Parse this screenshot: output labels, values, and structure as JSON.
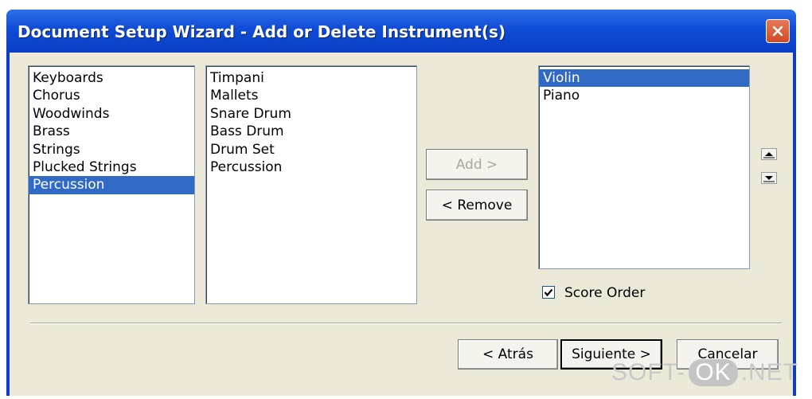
{
  "window": {
    "title": "Document Setup Wizard - Add or Delete Instrument(s)"
  },
  "categories": {
    "items": [
      "Keyboards",
      "Chorus",
      "Woodwinds",
      "Brass",
      "Strings",
      "Plucked Strings",
      "Percussion"
    ],
    "selected": "Percussion"
  },
  "instruments": {
    "items": [
      "Timpani",
      "Mallets",
      "Snare Drum",
      "Bass Drum",
      "Drum Set",
      "Percussion"
    ]
  },
  "selected_instruments": {
    "items": [
      "Violin",
      "Piano"
    ],
    "selected": "Violin"
  },
  "buttons": {
    "add": "Add >",
    "remove": "< Remove",
    "back": "< Atrás",
    "next": "Siguiente >",
    "cancel": "Cancelar"
  },
  "score_order": {
    "label": "Score Order",
    "checked": true
  },
  "watermark": {
    "left": "SOFT-",
    "ok": "OK",
    "right": ".NET"
  },
  "colors": {
    "selection": "#316ac5",
    "titlebar": "#0a3ec8",
    "dialog": "#ece9d8"
  }
}
